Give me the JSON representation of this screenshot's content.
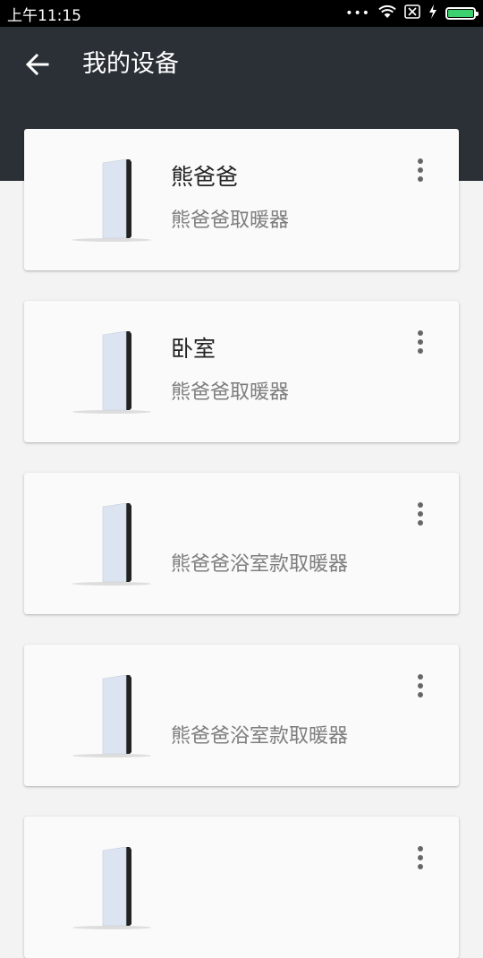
{
  "status": {
    "time": "上午11:15",
    "icons": [
      "dots-icon",
      "wifi-icon",
      "sim-icon",
      "charging-icon",
      "battery-icon"
    ]
  },
  "header": {
    "title": "我的设备",
    "back_icon": "back-arrow-icon"
  },
  "devices": [
    {
      "name": "熊爸爸",
      "model": "熊爸爸取暖器"
    },
    {
      "name": "卧室",
      "model": "熊爸爸取暖器"
    },
    {
      "name": "",
      "model": "熊爸爸浴室款取暖器"
    },
    {
      "name": "",
      "model": "熊爸爸浴室款取暖器"
    },
    {
      "name": "",
      "model": ""
    }
  ],
  "colors": {
    "header_bg": "#2b3037",
    "page_bg": "#f3f3f3",
    "card_bg": "#fafafa",
    "battery": "#3bd16f"
  }
}
